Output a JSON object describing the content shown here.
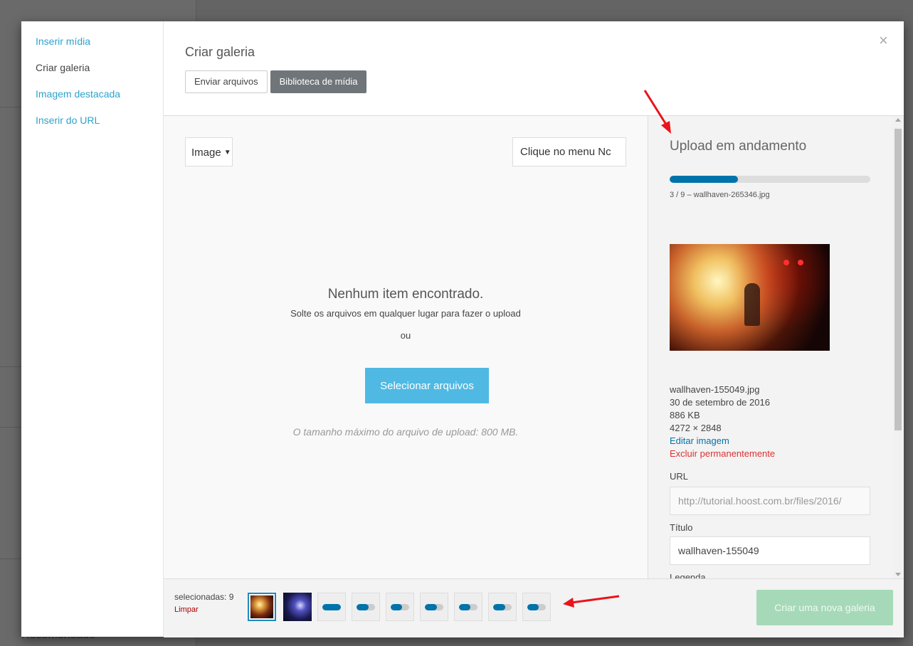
{
  "background": {
    "partial_text": "Recomendado"
  },
  "menu": {
    "items": [
      {
        "label": "Inserir mídia",
        "active": false
      },
      {
        "label": "Criar galeria",
        "active": true
      },
      {
        "label": "Imagem destacada",
        "active": false
      },
      {
        "label": "Inserir do URL",
        "active": false
      }
    ]
  },
  "frame": {
    "title": "Criar galeria",
    "close_glyph": "×",
    "tabs": [
      {
        "label": "Enviar arquivos",
        "active": false
      },
      {
        "label": "Biblioteca de mídia",
        "active": true
      }
    ]
  },
  "filters": {
    "type_selected": "Image",
    "search_placeholder": "Clique no menu Nc"
  },
  "empty_state": {
    "title": "Nenhum item encontrado.",
    "drop_text": "Solte os arquivos em qualquer lugar para fazer o upload",
    "or_text": "ou",
    "select_button": "Selecionar arquivos",
    "max_size": "O tamanho máximo do arquivo de upload: 800 MB."
  },
  "upload": {
    "title": "Upload em andamento",
    "progress": 0.34,
    "status": "3 / 9  –  wallhaven-265346.jpg"
  },
  "attachment": {
    "filename": "wallhaven-155049.jpg",
    "date": "30 de setembro de 2016",
    "size": "886 KB",
    "dimensions": "4272 × 2848",
    "edit_link": "Editar imagem",
    "delete_link": "Excluir permanentemente",
    "url_label": "URL",
    "url_value": "http://tutorial.hoost.com.br/files/2016/",
    "title_label": "Título",
    "title_value": "wallhaven-155049",
    "caption_label": "Legenda",
    "caption_value": ""
  },
  "toolbar": {
    "selected_count": "selecionadas: 9",
    "clear_label": "Limpar",
    "create_button": "Criar uma nova galeria",
    "thumb_progress": [
      1.0,
      0.65,
      0.6,
      0.65,
      0.6,
      0.65,
      0.6
    ]
  },
  "colors": {
    "accent": "#0073aa",
    "link": "#2ea2cc",
    "danger": "#dc3232",
    "primary_button": "#4fb9e3",
    "disabled_create": "#a6d9b8",
    "annotation_arrow": "#e8141c"
  }
}
